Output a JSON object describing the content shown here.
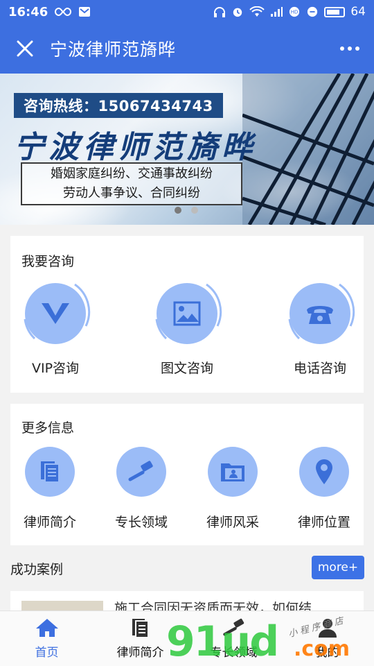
{
  "status_bar": {
    "time": "16:46",
    "battery": "64"
  },
  "header": {
    "title": "宁波律师范旖晔"
  },
  "banner": {
    "hotline": "咨询热线：15067434743",
    "title": "宁波律师范旖晔",
    "line1": "婚姻家庭纠纷、交通事故纠纷",
    "line2": "劳动人事争议、合同纠纷"
  },
  "consult": {
    "title": "我要咨询",
    "items": [
      {
        "label": "VIP咨询",
        "icon": "vip-icon"
      },
      {
        "label": "图文咨询",
        "icon": "image-icon"
      },
      {
        "label": "电话咨询",
        "icon": "phone-icon"
      }
    ]
  },
  "info": {
    "title": "更多信息",
    "items": [
      {
        "label": "律师简介",
        "icon": "document-icon"
      },
      {
        "label": "专长领域",
        "icon": "gavel-icon"
      },
      {
        "label": "律师风采",
        "icon": "folder-icon"
      },
      {
        "label": "律师位置",
        "icon": "location-pin-icon"
      }
    ]
  },
  "cases": {
    "title": "成功案例",
    "more_label": "more+",
    "first_case": "施工合同因无资质而无效，如何结…"
  },
  "tabbar": {
    "items": [
      {
        "label": "首页",
        "icon": "home-icon"
      },
      {
        "label": "律师简介",
        "icon": "document-icon"
      },
      {
        "label": "专长领域",
        "icon": "gavel-icon"
      },
      {
        "label": "我的",
        "icon": "user-icon"
      }
    ]
  },
  "watermark": {
    "brand": "91ud",
    "suffix": ".com",
    "tagline": "小程序商店"
  },
  "colors": {
    "primary": "#3d6fe0",
    "icon_circle": "#9bbcf7",
    "icon_glyph": "#3b6fd8"
  }
}
